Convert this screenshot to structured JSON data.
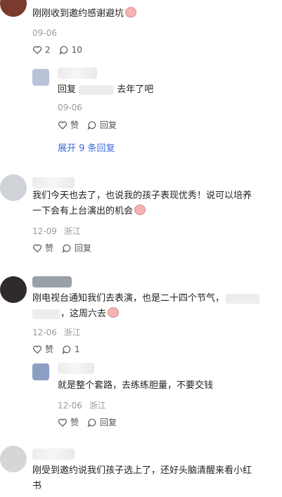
{
  "comments": [
    {
      "text": "刚刚收到邀约感谢避坑",
      "date": "09-06",
      "likes": "2",
      "replies_count": "10",
      "reply": {
        "prefix": "回复",
        "text": "去年了吧",
        "date": "09-06",
        "like_label": "赞",
        "reply_label": "回复"
      },
      "expand_label": "展开 9 条回复"
    },
    {
      "line1": "我们今天也去了，也说我的孩子表现优秀！说可以培养",
      "line2": "一下会有上台演出的机会",
      "date": "12-09",
      "location": "浙江",
      "like_label": "赞",
      "reply_label": "回复"
    },
    {
      "line1": "刚电视台通知我们去表演，也是二十四个节气，",
      "line2": "，这周六去",
      "date": "12-06",
      "location": "浙江",
      "like_label": "赞",
      "replies_count": "1",
      "reply": {
        "text": "就是整个套路，去练练胆量，不要交钱",
        "date": "12-06",
        "location": "浙江",
        "like_label": "赞",
        "reply_label": "回复"
      }
    },
    {
      "line1": "刚受到邀约说我们孩子选上了，还好头脑清醒来看小红",
      "line2": "书"
    }
  ]
}
